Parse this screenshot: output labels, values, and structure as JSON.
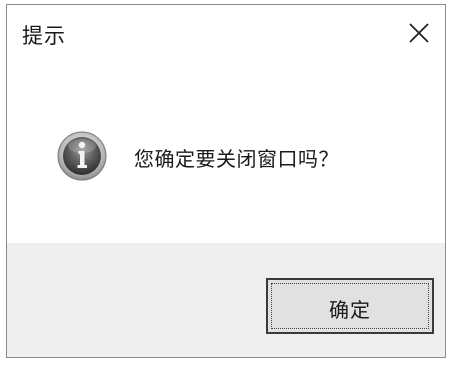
{
  "dialog": {
    "title": "提示",
    "message": "您确定要关闭窗口吗？",
    "icon": "info-icon",
    "ok_label": "确定",
    "close_icon": "close-icon"
  }
}
